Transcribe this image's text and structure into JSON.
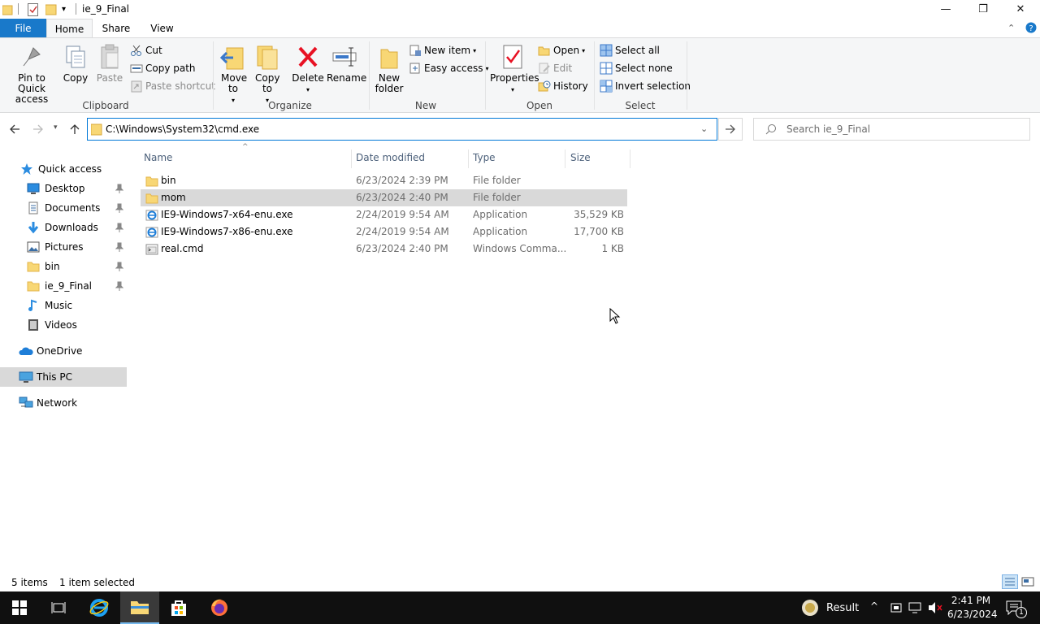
{
  "window": {
    "title": "ie_9_Final",
    "minimize_glyph": "—",
    "restore_glyph": "❐",
    "close_glyph": "✕"
  },
  "ribbon_tabs": [
    "File",
    "Home",
    "Share",
    "View"
  ],
  "ribbon": {
    "clipboard": {
      "label": "Clipboard",
      "pin": "Pin to Quick access",
      "copy": "Copy",
      "paste": "Paste",
      "cut": "Cut",
      "copy_path": "Copy path",
      "paste_shortcut": "Paste shortcut"
    },
    "organize": {
      "label": "Organize",
      "move_to": "Move to",
      "copy_to": "Copy to",
      "delete": "Delete",
      "rename": "Rename"
    },
    "new": {
      "label": "New",
      "new_folder": "New folder",
      "new_item": "New item",
      "easy_access": "Easy access"
    },
    "open": {
      "label": "Open",
      "properties": "Properties",
      "open": "Open",
      "edit": "Edit",
      "history": "History"
    },
    "select": {
      "label": "Select",
      "select_all": "Select all",
      "select_none": "Select none",
      "invert_selection": "Invert selection"
    }
  },
  "address": {
    "path": "C:\\Windows\\System32\\cmd.exe",
    "search_placeholder": "Search ie_9_Final"
  },
  "nav": {
    "quick_access": "Quick access",
    "items": [
      {
        "label": "Desktop",
        "pinned": true,
        "icon": "desktop-icon"
      },
      {
        "label": "Documents",
        "pinned": true,
        "icon": "documents-icon"
      },
      {
        "label": "Downloads",
        "pinned": true,
        "icon": "downloads-icon"
      },
      {
        "label": "Pictures",
        "pinned": true,
        "icon": "pictures-icon"
      },
      {
        "label": "bin",
        "pinned": true,
        "icon": "folder-icon"
      },
      {
        "label": "ie_9_Final",
        "pinned": true,
        "icon": "folder-icon"
      },
      {
        "label": "Music",
        "pinned": false,
        "icon": "music-icon"
      },
      {
        "label": "Videos",
        "pinned": false,
        "icon": "videos-icon"
      }
    ],
    "onedrive": "OneDrive",
    "this_pc": "This PC",
    "network": "Network"
  },
  "columns": {
    "name": "Name",
    "date": "Date modified",
    "type": "Type",
    "size": "Size"
  },
  "files": [
    {
      "name": "bin",
      "date": "6/23/2024 2:39 PM",
      "type": "File folder",
      "size": "",
      "icon": "folder-icon",
      "selected": false
    },
    {
      "name": "mom",
      "date": "6/23/2024 2:40 PM",
      "type": "File folder",
      "size": "",
      "icon": "folder-icon",
      "selected": true
    },
    {
      "name": "IE9-Windows7-x64-enu.exe",
      "date": "2/24/2019 9:54 AM",
      "type": "Application",
      "size": "35,529 KB",
      "icon": "ie-installer-icon",
      "selected": false
    },
    {
      "name": "IE9-Windows7-x86-enu.exe",
      "date": "2/24/2019 9:54 AM",
      "type": "Application",
      "size": "17,700 KB",
      "icon": "ie-installer-icon",
      "selected": false
    },
    {
      "name": "real.cmd",
      "date": "6/23/2024 2:40 PM",
      "type": "Windows Comma...",
      "size": "1 KB",
      "icon": "cmd-file-icon",
      "selected": false
    }
  ],
  "status": {
    "count": "5 items",
    "selection": "1 item selected"
  },
  "taskbar": {
    "result_label": "Result",
    "time": "2:41 PM",
    "date": "6/23/2024",
    "notification_count": "1"
  },
  "colors": {
    "accent": "#1979ca",
    "folder": "#f8d775",
    "taskbar": "#101010",
    "selection": "#d9d9d9"
  }
}
